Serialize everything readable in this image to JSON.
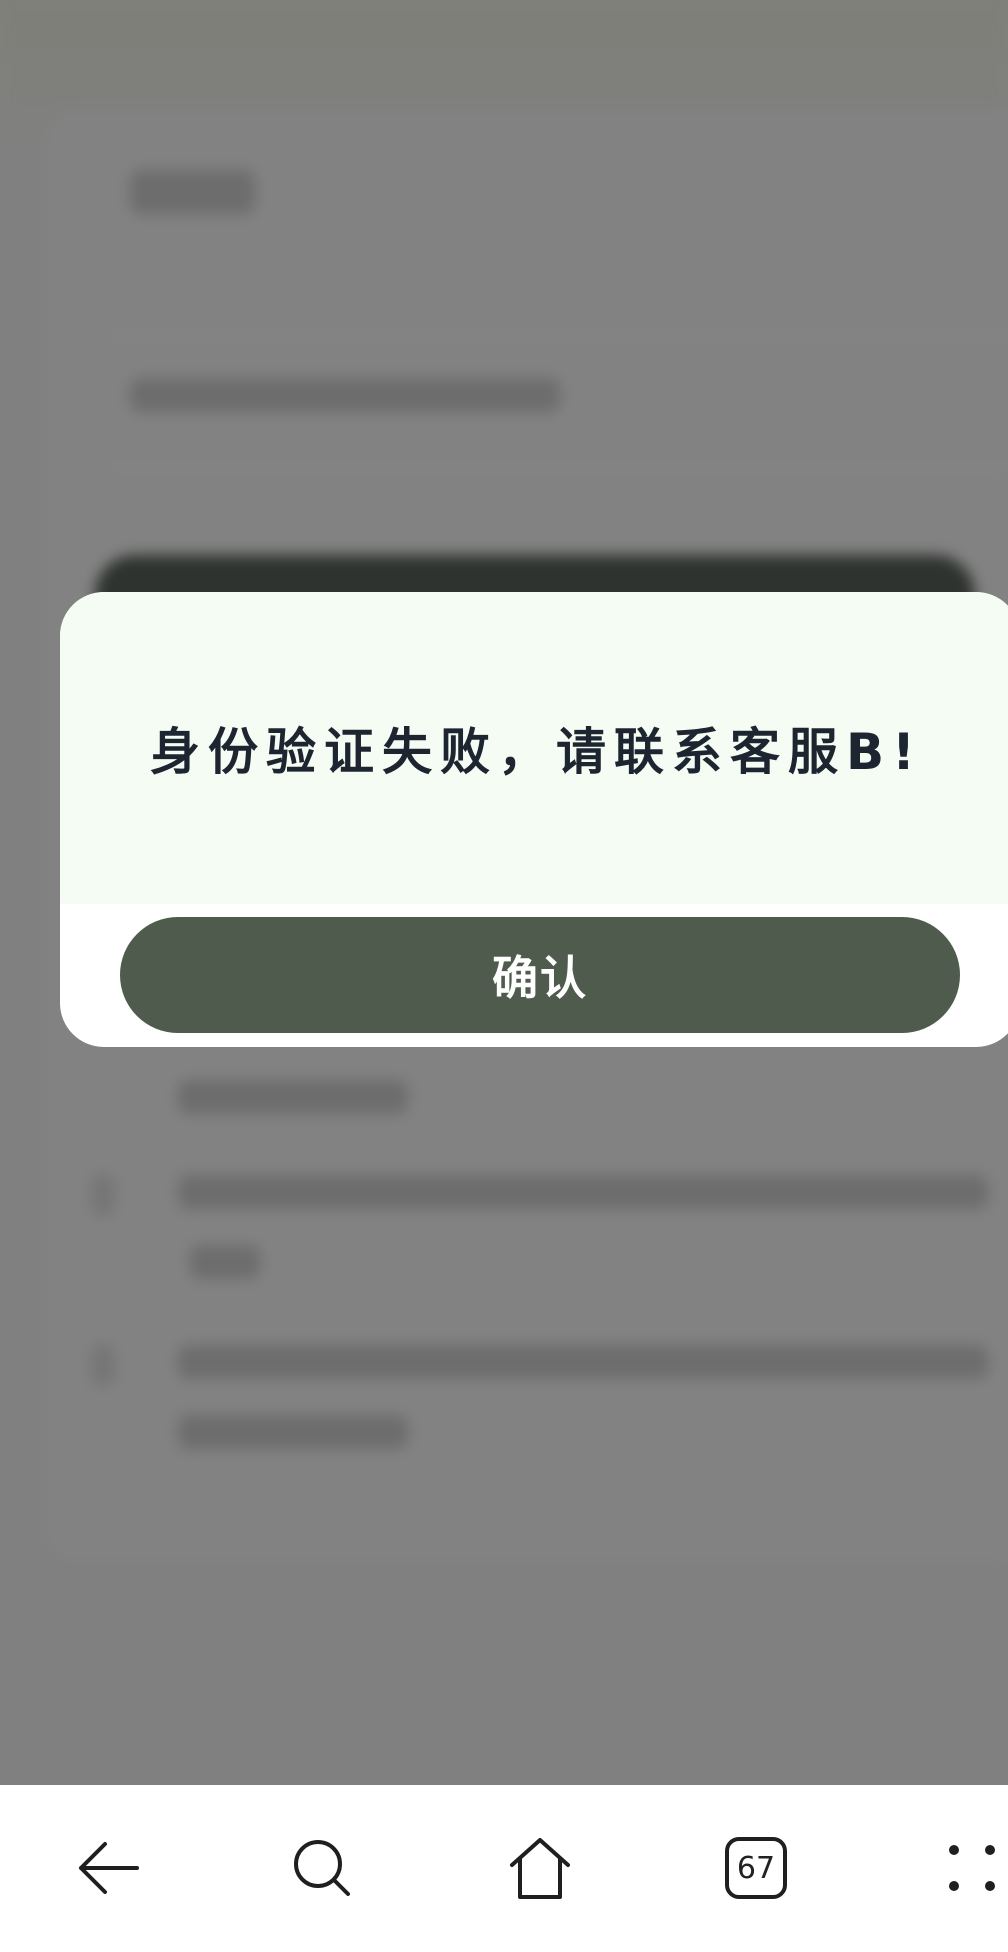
{
  "dialog": {
    "message": "身份验证失败，请联系客服B!",
    "confirm_label": "确认"
  },
  "nav": {
    "back_icon": "back-arrow-icon",
    "search_icon": "search-icon",
    "home_icon": "home-icon",
    "tabs_count": "67",
    "menu_icon": "more-dots-icon"
  },
  "colors": {
    "overlay": "#808080",
    "dialog_top": "#f5fcf3",
    "dialog_bg": "#ffffff",
    "button_bg": "#4e5b4d",
    "button_text": "#ffffff",
    "message_text": "#1d2530"
  }
}
